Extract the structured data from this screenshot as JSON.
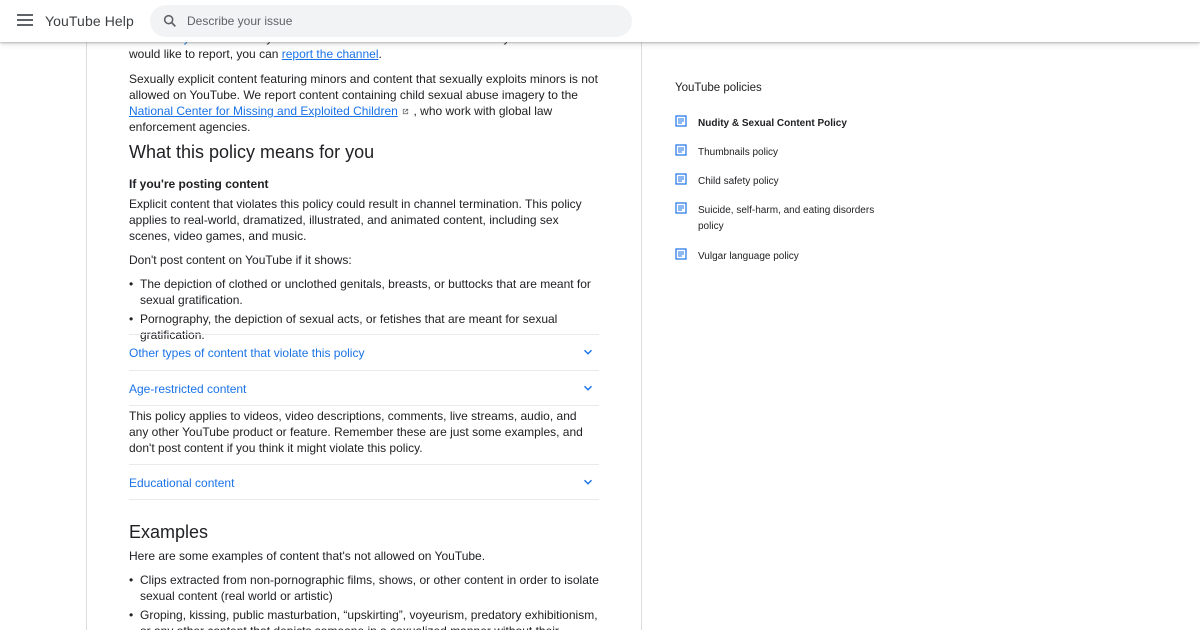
{
  "header": {
    "app_title": "YouTube Help",
    "search_placeholder": "Describe your issue"
  },
  "article": {
    "partial_top": {
      "line1_hidden": "Community Guidelines",
      "tail_text": ". If you've found a few videos or comments that you",
      "line2_text": "would like to report, you can ",
      "report_link": "report the channel",
      "period": "."
    },
    "minors_para": {
      "text": "Sexually explicit content featuring minors and content that sexually exploits minors is not allowed on YouTube. We report content containing child sexual abuse imagery to the ",
      "link": "National Center for Missing and Exploited Children",
      "after": " , who work with global law enforcement agencies."
    },
    "section_heading": "What this policy means for you",
    "posting_heading": "If you're posting content",
    "posting_para": "Explicit content that violates this policy could result in channel termination. This policy applies to real-world, dramatized, illustrated, and animated content, including sex scenes, video games, and music.",
    "dont_post": "Don't post content on YouTube if it shows:",
    "bullets": [
      "The depiction of clothed or unclothed genitals, breasts, or buttocks that are meant for sexual gratification.",
      "Pornography, the depiction of sexual acts, or fetishes that are meant for sexual gratification."
    ],
    "accordion1": "Other types of content that violate this policy",
    "accordion2": "Age-restricted content",
    "applies_para": "This policy applies to videos, video descriptions, comments, live streams, audio, and any other YouTube product or feature. Remember these are just some examples, and don't post content if you think it might violate this policy.",
    "accordion3": "Educational content",
    "examples_heading": "Examples",
    "examples_intro": "Here are some examples of content that's not allowed on YouTube.",
    "example_bullets": [
      "Clips extracted from non-pornographic films, shows, or other content in order to isolate sexual content (real world or artistic)",
      "Groping, kissing, public masturbation, “upskirting”, voyeurism, predatory exhibitionism, or any other content that depicts someone in a sexualized manner without their consent"
    ]
  },
  "sidebar": {
    "title": "YouTube policies",
    "items": [
      {
        "label": "Nudity & Sexual Content Policy",
        "active": true
      },
      {
        "label": "Thumbnails policy"
      },
      {
        "label": "Child safety policy"
      },
      {
        "label": "Suicide, self-harm, and eating disorders policy"
      },
      {
        "label": "Vulgar language policy"
      }
    ]
  },
  "colors": {
    "link": "#1a73e8",
    "icon": "#1a73e8",
    "text": "#202124",
    "divider": "#dadce0"
  },
  "icons": [
    "menu-icon",
    "search-icon",
    "chevron-down-icon",
    "document-list-icon",
    "external-link-icon"
  ]
}
